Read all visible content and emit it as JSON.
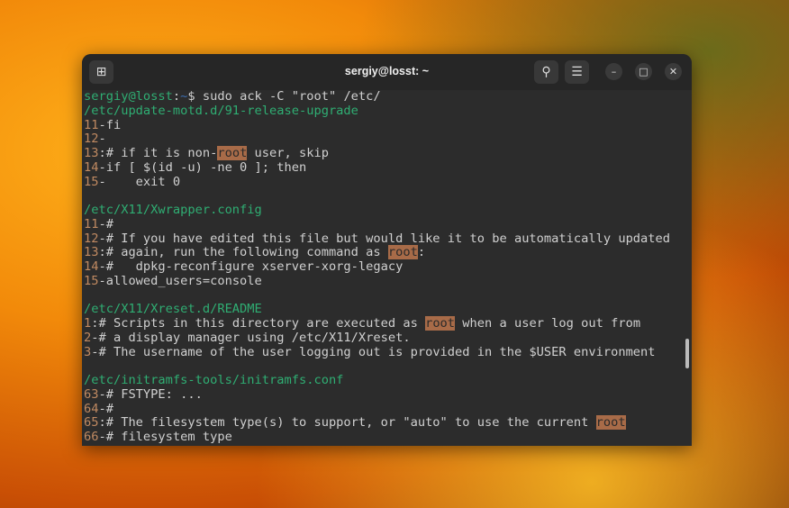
{
  "window": {
    "title": "sergiy@losst: ~",
    "icons": {
      "new_tab": "new-tab-icon",
      "search": "search-icon",
      "menu": "hamburger-menu-icon",
      "minimize": "minimize-icon",
      "maximize": "maximize-icon",
      "close": "close-icon"
    },
    "glyphs": {
      "new_tab": "⊞",
      "search": "⚲",
      "menu": "☰",
      "minimize": "–",
      "maximize": "□",
      "close": "✕"
    }
  },
  "colors": {
    "path": "#2fae73",
    "line_number": "#c08a62",
    "match_highlight": "#a86b48"
  },
  "terminal": {
    "lines": [
      [
        [
          "prompt",
          "sergiy@losst"
        ],
        [
          "text",
          ":"
        ],
        [
          "tilde",
          "~"
        ],
        [
          "text",
          "$ sudo ack -C \"root\" /etc/"
        ]
      ],
      [
        [
          "path",
          "/etc/update-motd.d/91-release-upgrade"
        ]
      ],
      [
        [
          "num",
          "11"
        ],
        [
          "text",
          "-fi"
        ]
      ],
      [
        [
          "num",
          "12"
        ],
        [
          "text",
          "-"
        ]
      ],
      [
        [
          "num",
          "13"
        ],
        [
          "text",
          ":# if it is non-"
        ],
        [
          "hl",
          "root"
        ],
        [
          "text",
          " user, skip"
        ]
      ],
      [
        [
          "num",
          "14"
        ],
        [
          "text",
          "-if [ $(id -u) -ne 0 ]; then"
        ]
      ],
      [
        [
          "num",
          "15"
        ],
        [
          "text",
          "-    exit 0"
        ]
      ],
      [],
      [
        [
          "path",
          "/etc/X11/Xwrapper.config"
        ]
      ],
      [
        [
          "num",
          "11"
        ],
        [
          "text",
          "-#"
        ]
      ],
      [
        [
          "num",
          "12"
        ],
        [
          "text",
          "-# If you have edited this file but would like it to be automatically updated"
        ]
      ],
      [
        [
          "num",
          "13"
        ],
        [
          "text",
          ":# again, run the following command as "
        ],
        [
          "hl",
          "root"
        ],
        [
          "text",
          ":"
        ]
      ],
      [
        [
          "num",
          "14"
        ],
        [
          "text",
          "-#   dpkg-reconfigure xserver-xorg-legacy"
        ]
      ],
      [
        [
          "num",
          "15"
        ],
        [
          "text",
          "-allowed_users=console"
        ]
      ],
      [],
      [
        [
          "path",
          "/etc/X11/Xreset.d/README"
        ]
      ],
      [
        [
          "num",
          "1"
        ],
        [
          "text",
          ":# Scripts in this directory are executed as "
        ],
        [
          "hl",
          "root"
        ],
        [
          "text",
          " when a user log out from"
        ]
      ],
      [
        [
          "num",
          "2"
        ],
        [
          "text",
          "-# a display manager using /etc/X11/Xreset."
        ]
      ],
      [
        [
          "num",
          "3"
        ],
        [
          "text",
          "-# The username of the user logging out is provided in the $USER environment"
        ]
      ],
      [],
      [
        [
          "path",
          "/etc/initramfs-tools/initramfs.conf"
        ]
      ],
      [
        [
          "num",
          "63"
        ],
        [
          "text",
          "-# FSTYPE: ..."
        ]
      ],
      [
        [
          "num",
          "64"
        ],
        [
          "text",
          "-#"
        ]
      ],
      [
        [
          "num",
          "65"
        ],
        [
          "text",
          ":# The filesystem type(s) to support, or \"auto\" to use the current "
        ],
        [
          "hl",
          "root"
        ]
      ],
      [
        [
          "num",
          "66"
        ],
        [
          "text",
          "-# filesystem type"
        ]
      ]
    ]
  }
}
